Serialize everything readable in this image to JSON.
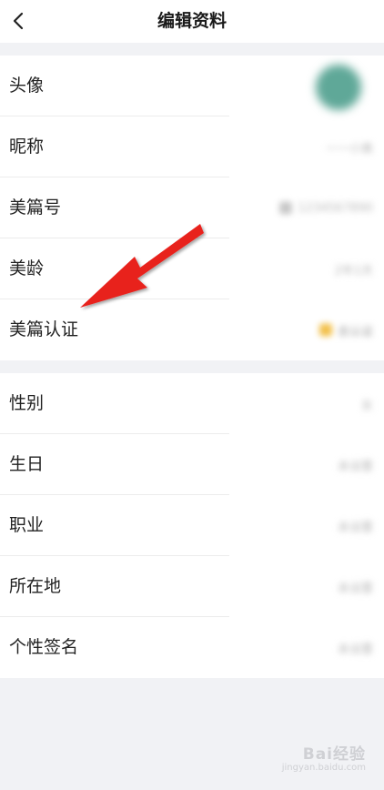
{
  "nav": {
    "title": "编辑资料",
    "back_icon": "chevron-left-icon"
  },
  "profile": {
    "avatar_label": "头像",
    "nickname_label": "昵称",
    "nickname_value": "一一小美",
    "meipian_id_label": "美篇号",
    "meipian_id_value": "1234567890",
    "meiling_label": "美龄",
    "meiling_value": "2年1天",
    "certification_label": "美篇认证",
    "certification_value": "去认证"
  },
  "personal": {
    "gender_label": "性别",
    "gender_value": "女",
    "birthday_label": "生日",
    "birthday_value": "未设置",
    "job_label": "职业",
    "job_value": "未设置",
    "location_label": "所在地",
    "location_value": "未设置",
    "signature_label": "个性签名",
    "signature_value": "未设置"
  },
  "watermark": {
    "brand": "Bai经验",
    "url": "jingyan.baidu.com"
  },
  "colors": {
    "background": "#f1f2f5",
    "surface": "#ffffff",
    "arrow": "#e8201e",
    "avatar": "#5fa898"
  }
}
